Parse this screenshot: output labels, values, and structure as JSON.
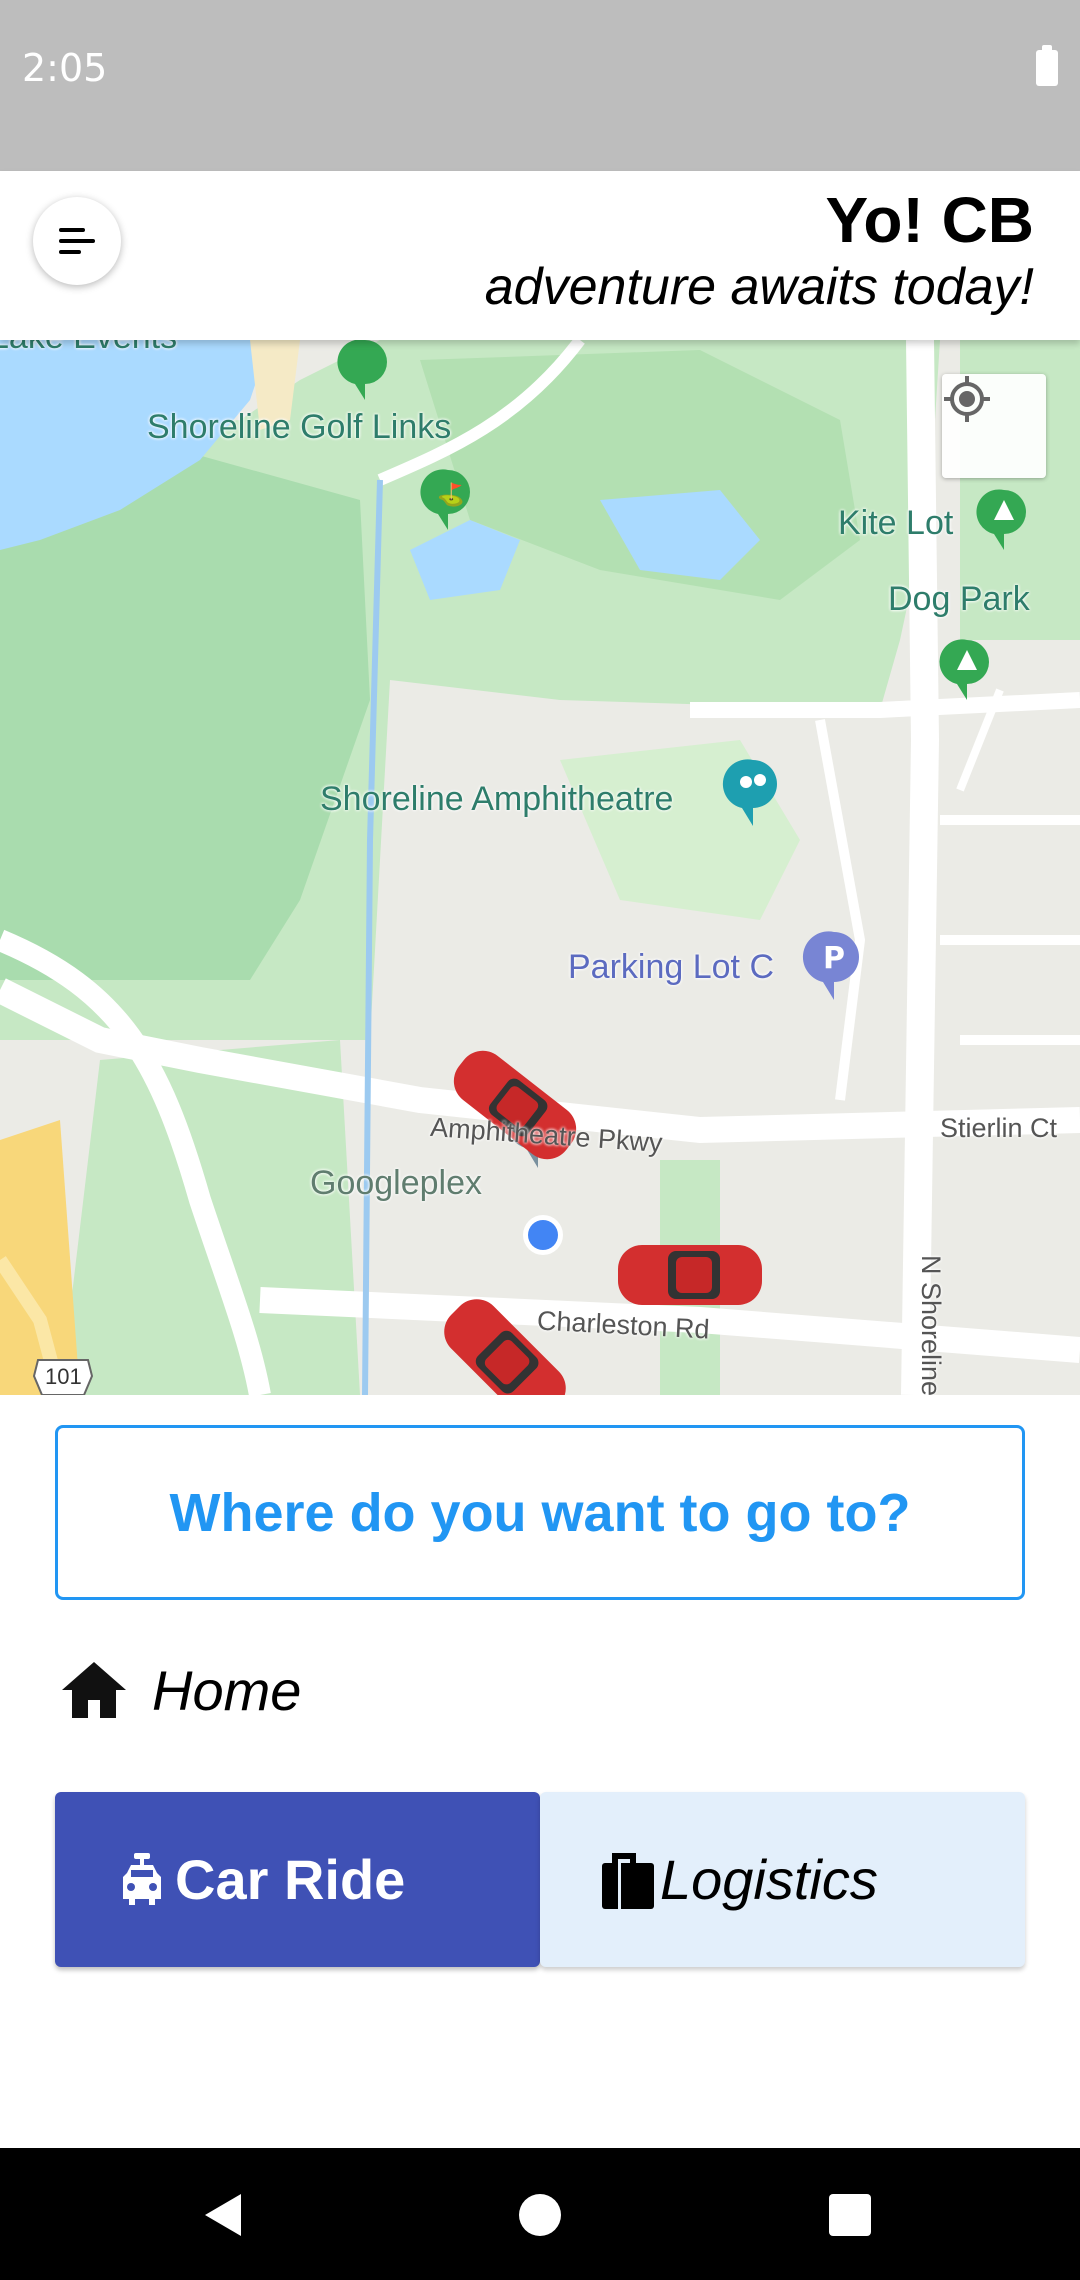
{
  "status_bar": {
    "time": "2:05",
    "battery_icon": "battery-full-icon"
  },
  "header": {
    "menu_icon": "menu-icon",
    "title": "Yo! CB",
    "tagline": "adventure awaits today!"
  },
  "map": {
    "labels": {
      "lake_events": "Lake Events",
      "golf_links": "Shoreline Golf Links",
      "kite_lot": "Kite Lot",
      "dog_park": "Dog Park",
      "amphitheatre": "Shoreline Amphitheatre",
      "parking_lot_c": "Parking Lot C",
      "googleplex": "Googleplex",
      "amphitheatre_pkwy": "Amphitheatre Pkwy",
      "stierlin_ct": "Stierlin Ct",
      "charleston_rd": "Charleston Rd",
      "n_shoreline": "N Shoreline",
      "route_101": "101"
    },
    "locate_icon": "my-location-icon",
    "vehicle_icon": "red-car-icon"
  },
  "booking": {
    "search_label": "Where do you want to go to?",
    "home_label": "Home",
    "home_icon": "home-icon",
    "car_ride_label": "Car Ride",
    "car_ride_icon": "car-icon",
    "logistics_label": "Logistics",
    "logistics_icon": "luggage-icon",
    "accent_color": "#2196f3",
    "car_ride_color": "#3f51b5",
    "logistics_color": "#e3effb"
  },
  "nav_bar": {
    "back_icon": "back-triangle-icon",
    "home_icon": "home-circle-icon",
    "recents_icon": "recents-square-icon"
  }
}
